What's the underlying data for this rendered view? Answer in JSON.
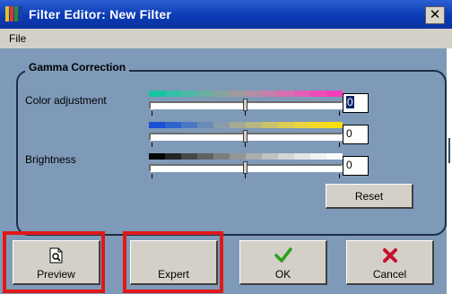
{
  "window": {
    "title": "Filter Editor: New Filter",
    "close_glyph": "✕"
  },
  "menu": {
    "items": [
      "File"
    ]
  },
  "gamma": {
    "group_label": "Gamma Correction",
    "color_adjustment_label": "Color adjustment",
    "brightness_label": "Brightness",
    "sliders": [
      {
        "name": "color-slider-1",
        "value": "0",
        "position": 0.5
      },
      {
        "name": "color-slider-2",
        "value": "0",
        "position": 0.5
      },
      {
        "name": "brightness-slider",
        "value": "0",
        "position": 0.5
      }
    ],
    "reset_label": "Reset"
  },
  "buttons": {
    "preview": "Preview",
    "expert": "Expert",
    "ok": "OK",
    "cancel": "Cancel"
  },
  "icons": {
    "app": "filter-app-icon",
    "preview": "preview-document-icon",
    "ok": "green-check-icon",
    "cancel": "red-x-icon"
  },
  "colors": {
    "client_bg": "#7e9ab8",
    "title_bar": "#0a3ab6",
    "highlight": "#e01818",
    "ok_check": "#2aa11f",
    "cancel_x": "#c8102e"
  }
}
